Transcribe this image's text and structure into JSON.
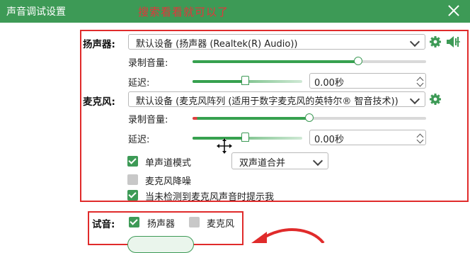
{
  "window": {
    "title": "声音调试设置",
    "annotation": "搜索看看就可以了"
  },
  "speaker": {
    "label": "扬声器:",
    "device": "默认设备 (扬声器 (Realtek(R) Audio))",
    "volume_label": "录制音量:",
    "volume_level": 0.71,
    "delay_label": "延迟:",
    "delay_level": 0.48,
    "delay_value": "0.00秒"
  },
  "mic": {
    "label": "麦克风:",
    "device": "默认设备 (麦克风阵列 (适用于数字麦克风的英特尔® 智音技术))",
    "volume_label": "录制音量:",
    "volume_level": 0.5,
    "delay_label": "延迟:",
    "delay_level": 0.48,
    "delay_value": "0.00秒",
    "mono_label": "单声道模式",
    "mono_checked": true,
    "mono_mode": "双声道合并",
    "denoise_label": "麦克风降噪",
    "denoise_checked": false,
    "prompt_label": "当未检测到麦克风声音时提示我",
    "prompt_checked": true
  },
  "test": {
    "label": "试音:",
    "speaker_label": "扬声器",
    "speaker_checked": true,
    "mic_label": "麦克风",
    "mic_checked": false
  },
  "colors": {
    "brand": "#3d9a56",
    "annotation": "#e02b2b"
  }
}
